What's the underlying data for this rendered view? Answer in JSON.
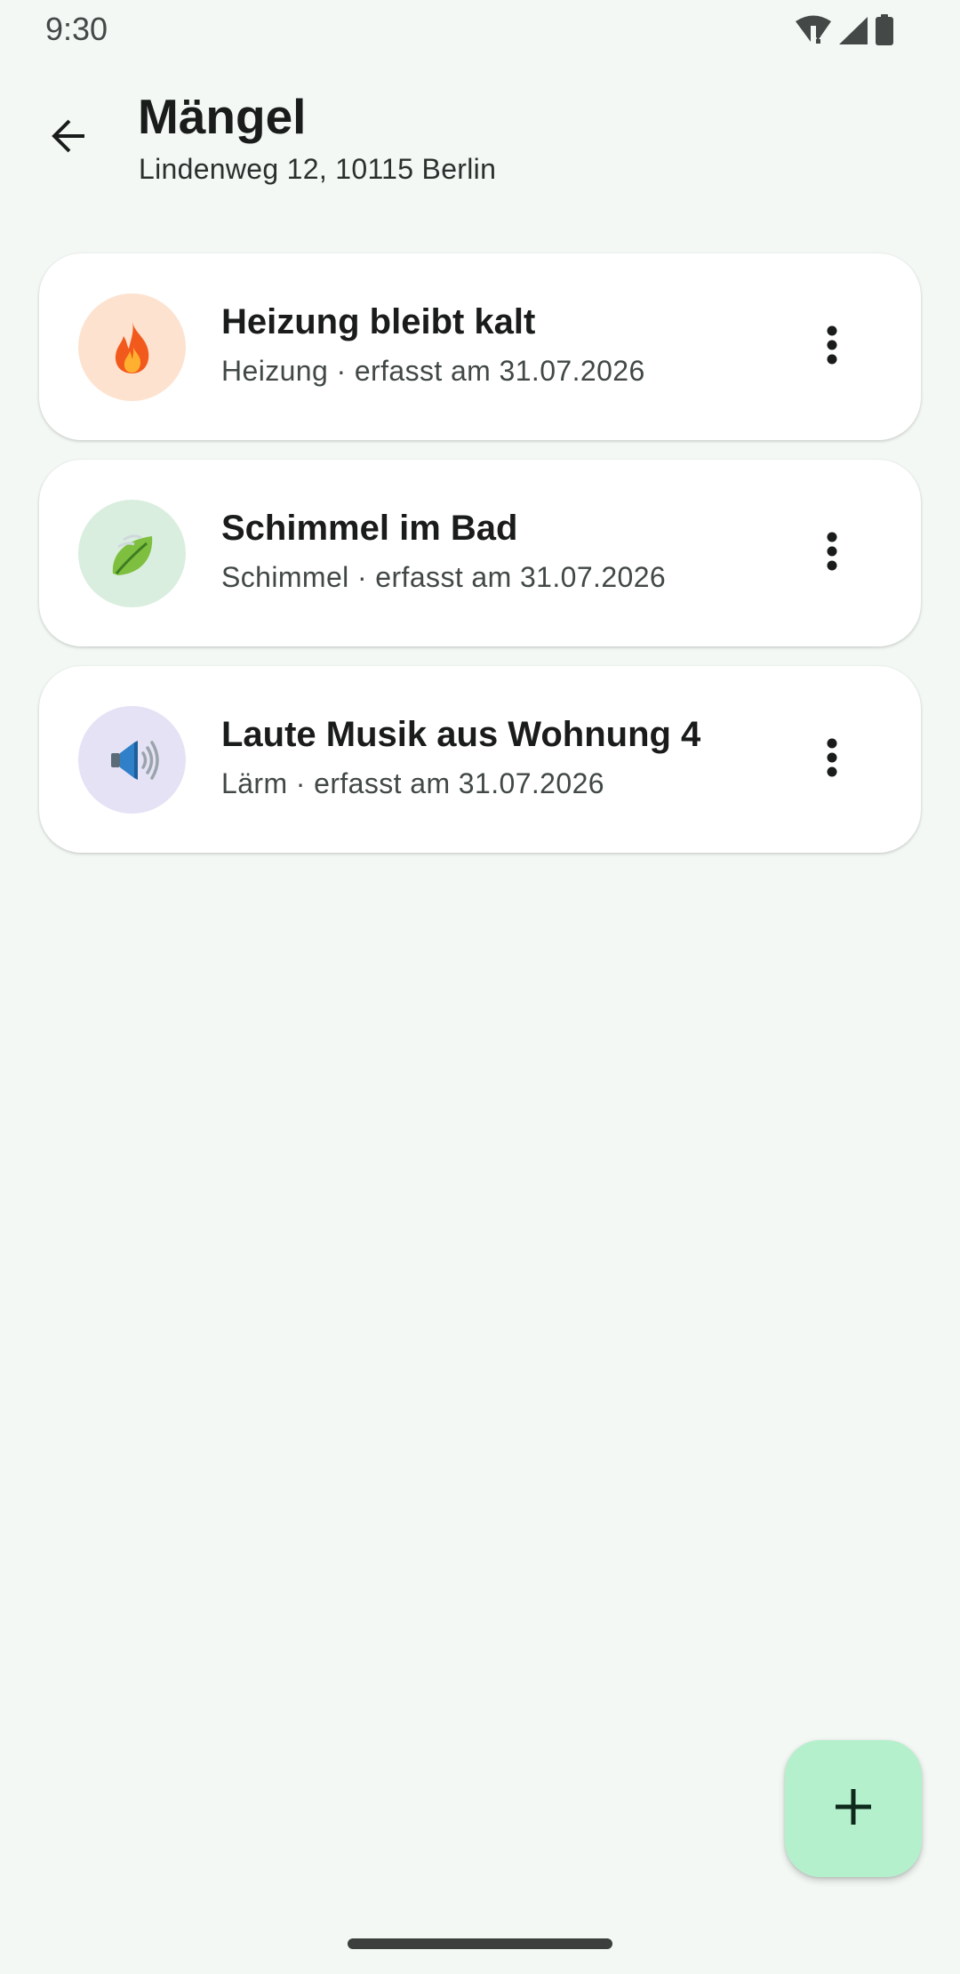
{
  "status_bar": {
    "time": "9:30",
    "icons": [
      "wifi-alert-icon",
      "cellular-signal-icon",
      "battery-icon"
    ]
  },
  "header": {
    "back_icon": "arrow-back-icon",
    "title": "Mängel",
    "subtitle": "Lindenweg 12, 10115 Berlin"
  },
  "defects": [
    {
      "title": "Heizung bleibt kalt",
      "meta": "Heizung · erfasst am 31.07.2026",
      "icon": "fire-icon",
      "avatar_color": "#fde2cf"
    },
    {
      "title": "Schimmel im Bad",
      "meta": "Schimmel · erfasst am 31.07.2026",
      "icon": "leaf-icon",
      "avatar_color": "#d9eedf"
    },
    {
      "title": "Laute Musik aus Wohnung 4",
      "meta": "Lärm · erfasst am 31.07.2026",
      "icon": "loudspeaker-icon",
      "avatar_color": "#e5e2f6"
    }
  ],
  "fab": {
    "icon": "plus-icon",
    "color": "#b5f0cd"
  },
  "colors": {
    "background": "#f3f8f4",
    "card": "#ffffff",
    "text_primary": "#191c1b",
    "text_secondary": "#414845"
  }
}
